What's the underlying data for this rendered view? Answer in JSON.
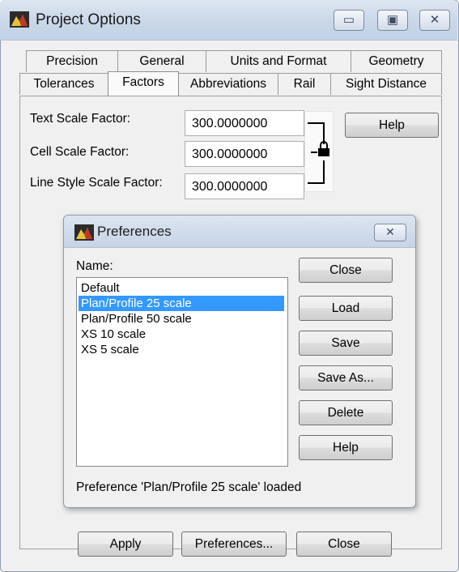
{
  "window": {
    "title": "Project Options",
    "minimize_glyph": "▭",
    "maximize_glyph": "▣",
    "close_glyph": "✕"
  },
  "tabs_top": [
    "Precision",
    "General",
    "Units and Format",
    "Geometry"
  ],
  "tabs_bottom": [
    "Tolerances",
    "Factors",
    "Abbreviations",
    "Rail",
    "Sight Distance"
  ],
  "factors": {
    "text_label": "Text Scale Factor:",
    "text_value": "300.0000000",
    "cell_label": "Cell Scale Factor:",
    "cell_value": "300.0000000",
    "line_label": "Line Style Scale Factor:",
    "line_value": "300.0000000",
    "help": "Help"
  },
  "preferences": {
    "title": "Preferences",
    "close_glyph": "✕",
    "name_label": "Name:",
    "items": [
      "Default",
      "Plan/Profile 25 scale",
      "Plan/Profile 50 scale",
      "XS 10 scale",
      "XS 5 scale"
    ],
    "selected": "Plan/Profile 25 scale",
    "buttons": {
      "close": "Close",
      "load": "Load",
      "save": "Save",
      "save_as": "Save As...",
      "delete": "Delete",
      "help": "Help"
    },
    "status": "Preference 'Plan/Profile 25 scale' loaded"
  },
  "bottom_buttons": {
    "apply": "Apply",
    "preferences": "Preferences...",
    "close": "Close"
  }
}
